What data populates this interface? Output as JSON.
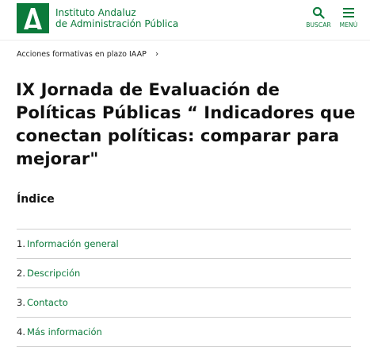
{
  "header": {
    "brand_line1": "Instituto Andaluz",
    "brand_line2": "de Administración Pública",
    "search_label": "BUSCAR",
    "menu_label": "MENÚ",
    "brand_color": "#0b7a3b"
  },
  "breadcrumb": {
    "item": "Acciones formativas en plazo IAAP",
    "chevron": "›"
  },
  "page": {
    "title": "IX Jornada de Evaluación de Políticas Públicas “ Indicadores que conectan políticas: comparar para mejorar\"",
    "index_heading": "Índice"
  },
  "index": [
    {
      "num": "1.",
      "label": "Información general"
    },
    {
      "num": "2.",
      "label": "Descripción"
    },
    {
      "num": "3.",
      "label": "Contacto"
    },
    {
      "num": "4.",
      "label": "Más información"
    }
  ]
}
